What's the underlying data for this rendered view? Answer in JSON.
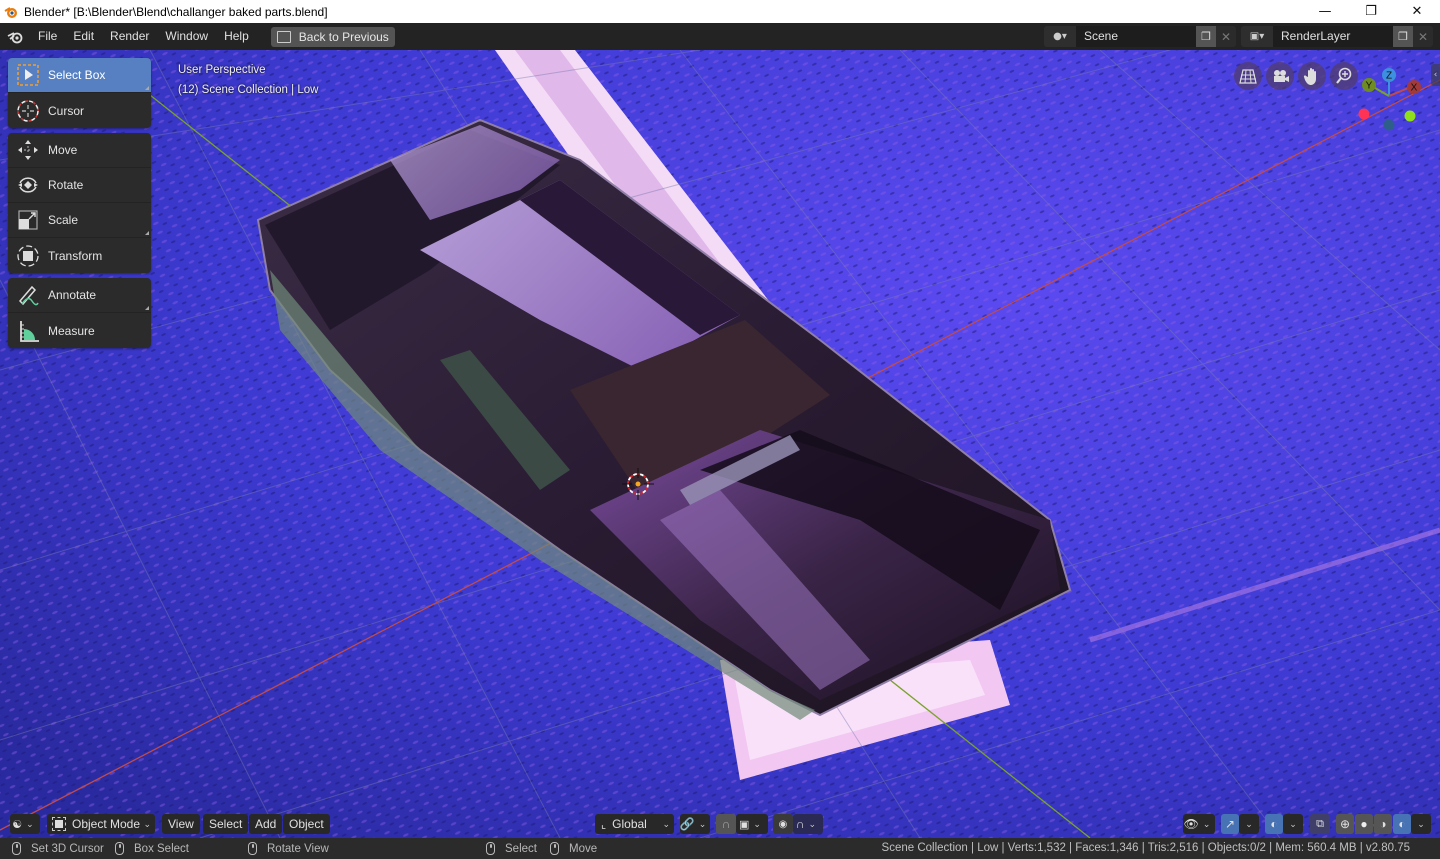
{
  "window": {
    "title": "Blender* [B:\\Blender\\Blend\\challanger baked parts.blend]",
    "controls": {
      "minimize": "—",
      "maximize": "❐",
      "close": "✕"
    }
  },
  "topbar": {
    "menus": [
      "File",
      "Edit",
      "Render",
      "Window",
      "Help"
    ],
    "back_button": "Back to Previous",
    "scene": {
      "icon": "scene-icon",
      "value": "Scene"
    },
    "render_layer": {
      "icon": "render-layer-icon",
      "value": "RenderLayer"
    }
  },
  "toolbar": {
    "groups": [
      [
        {
          "label": "Select Box",
          "icon": "select-box-icon",
          "active": true,
          "has_submenu": true
        },
        {
          "label": "Cursor",
          "icon": "cursor-icon",
          "active": false,
          "has_submenu": false
        }
      ],
      [
        {
          "label": "Move",
          "icon": "move-icon",
          "active": false,
          "has_submenu": false
        },
        {
          "label": "Rotate",
          "icon": "rotate-icon",
          "active": false,
          "has_submenu": false
        },
        {
          "label": "Scale",
          "icon": "scale-icon",
          "active": false,
          "has_submenu": true
        },
        {
          "label": "Transform",
          "icon": "transform-icon",
          "active": false,
          "has_submenu": false
        }
      ],
      [
        {
          "label": "Annotate",
          "icon": "annotate-icon",
          "active": false,
          "has_submenu": true
        },
        {
          "label": "Measure",
          "icon": "measure-icon",
          "active": false,
          "has_submenu": false
        }
      ]
    ]
  },
  "viewport": {
    "view_name": "User Perspective",
    "collection_info": "(12) Scene Collection | Low",
    "nav_buttons": [
      "toggle-camera-ortho-icon",
      "camera-icon",
      "pan-hand-icon",
      "zoom-icon"
    ],
    "gizmo_axes": {
      "x": "X",
      "y": "Y",
      "z": "Z"
    },
    "colors": {
      "x_axis": "#c24a4a",
      "y_axis": "#7aa32a",
      "z_axis": "#3d8fe0",
      "floor": "#3a36c8"
    }
  },
  "header_bottom": {
    "editor_type_icon": "view3d-icon",
    "mode": "Object Mode",
    "menus": [
      "View",
      "Select",
      "Add",
      "Object"
    ],
    "orientation": "Global",
    "pivot_icon": "pivot-link-icon",
    "snap_icon": "snap-magnet-icon",
    "snap_target_icon": "snap-target-icon",
    "proportional_icon": "proportional-edit-icon",
    "falloff_icon": "falloff-curve-icon",
    "right_icons": [
      "visibility-eye-icon",
      "gizmo-toggle-icon",
      "overlay-toggle-icon",
      "xray-toggle-icon",
      "wireframe-shading-icon",
      "solid-shading-icon",
      "material-shading-icon",
      "rendered-shading-icon"
    ]
  },
  "statusbar": {
    "hints": [
      {
        "icon": "mouse-left-icon",
        "label": "Set 3D Cursor"
      },
      {
        "icon": "mouse-drag-icon",
        "label": "Box Select"
      },
      {
        "icon": "mouse-middle-icon",
        "label": "Rotate View"
      },
      {
        "icon": "mouse-left-icon",
        "label": "Select"
      },
      {
        "icon": "mouse-drag-icon",
        "label": "Move"
      }
    ],
    "stats": "Scene Collection | Low | Verts:1,532 | Faces:1,346 | Tris:2,516 | Objects:0/2 | Mem: 560.4 MB | v2.80.75"
  }
}
